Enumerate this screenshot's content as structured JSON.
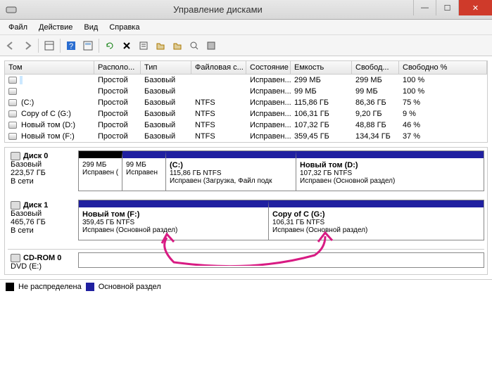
{
  "window": {
    "title": "Управление дисками",
    "min": "—",
    "max": "☐",
    "close": "✕"
  },
  "menu": [
    "Файл",
    "Действие",
    "Вид",
    "Справка"
  ],
  "columns": {
    "vol": "Том",
    "loc": "Располо...",
    "typ": "Тип",
    "fs": "Файловая с...",
    "st": "Состояние",
    "cap": "Емкость",
    "fr": "Свобод...",
    "fp": "Свободно %"
  },
  "rows": [
    {
      "name": "",
      "loc": "Простой",
      "typ": "Базовый",
      "fs": "",
      "st": "Исправен...",
      "cap": "299 МБ",
      "fr": "299 МБ",
      "fp": "100 %",
      "sel": true
    },
    {
      "name": "",
      "loc": "Простой",
      "typ": "Базовый",
      "fs": "",
      "st": "Исправен...",
      "cap": "99 МБ",
      "fr": "99 МБ",
      "fp": "100 %"
    },
    {
      "name": "(C:)",
      "loc": "Простой",
      "typ": "Базовый",
      "fs": "NTFS",
      "st": "Исправен...",
      "cap": "115,86 ГБ",
      "fr": "86,36 ГБ",
      "fp": "75 %"
    },
    {
      "name": "Copy of C (G:)",
      "loc": "Простой",
      "typ": "Базовый",
      "fs": "NTFS",
      "st": "Исправен...",
      "cap": "106,31 ГБ",
      "fr": "9,20 ГБ",
      "fp": "9 %",
      "pink": true
    },
    {
      "name": "Новый том (D:)",
      "loc": "Простой",
      "typ": "Базовый",
      "fs": "NTFS",
      "st": "Исправен...",
      "cap": "107,32 ГБ",
      "fr": "48,88 ГБ",
      "fp": "46 %"
    },
    {
      "name": "Новый том (F:)",
      "loc": "Простой",
      "typ": "Базовый",
      "fs": "NTFS",
      "st": "Исправен...",
      "cap": "359,45 ГБ",
      "fr": "134,34 ГБ",
      "fp": "37 %"
    }
  ],
  "disks": {
    "d0": {
      "name": "Диск 0",
      "type": "Базовый",
      "size": "223,57 ГБ",
      "status": "В сети"
    },
    "d1": {
      "name": "Диск 1",
      "type": "Базовый",
      "size": "465,76 ГБ",
      "status": "В сети"
    },
    "cd": {
      "name": "CD-ROM 0",
      "sub": "DVD (E:)"
    }
  },
  "parts": {
    "p0a": {
      "size": "299 МБ",
      "stat": "Исправен (Ра"
    },
    "p0b": {
      "size": "99 МБ",
      "stat": "Исправен"
    },
    "p0c": {
      "title": "(C:)",
      "size": "115,86 ГБ NTFS",
      "stat": "Исправен (Загрузка, Файл подк"
    },
    "p0d": {
      "title": "Новый том  (D:)",
      "size": "107,32 ГБ NTFS",
      "stat": "Исправен (Основной раздел)"
    },
    "p1a": {
      "title": "Новый том  (F:)",
      "size": "359,45 ГБ NTFS",
      "stat": "Исправен (Основной раздел)"
    },
    "p1b": {
      "title": "Copy of C  (G:)",
      "size": "106,31 ГБ NTFS",
      "stat": "Исправен (Основной раздел)"
    }
  },
  "legend": {
    "unalloc": "Не распределена",
    "primary": "Основной раздел"
  }
}
